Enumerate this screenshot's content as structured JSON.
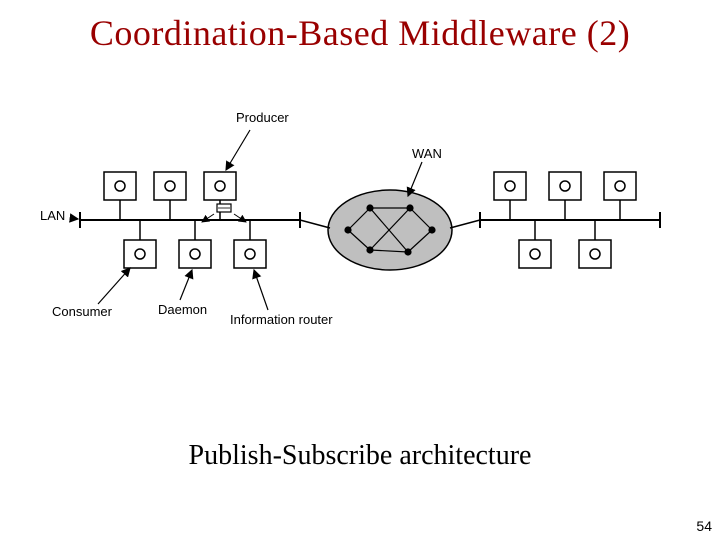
{
  "title": "Coordination-Based Middleware (2)",
  "caption": "Publish-Subscribe architecture",
  "page_number": "54",
  "diagram": {
    "labels": {
      "producer": "Producer",
      "wan": "WAN",
      "lan": "LAN",
      "consumer": "Consumer",
      "daemon": "Daemon",
      "info_router": "Information router"
    }
  }
}
